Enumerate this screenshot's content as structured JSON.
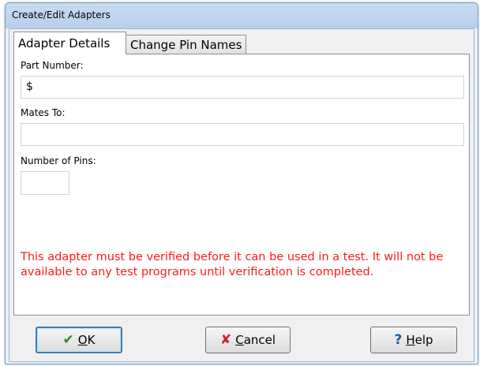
{
  "window": {
    "title": "Create/Edit Adapters"
  },
  "tabs": [
    {
      "label": "Adapter Details",
      "active": true
    },
    {
      "label": "Change Pin Names",
      "active": false
    }
  ],
  "form": {
    "part_number_label": "Part Number:",
    "part_number_value": "$",
    "mates_to_label": "Mates To:",
    "mates_to_value": "",
    "num_pins_label": "Number of Pins:",
    "num_pins_value": ""
  },
  "warning": "This adapter must be verified before it can be used in a test.  It will not be available to any test programs until verification is completed.",
  "buttons": {
    "ok": {
      "mnemonic": "O",
      "rest": "K",
      "icon": "check-icon"
    },
    "cancel": {
      "mnemonic": "C",
      "rest": "ancel",
      "icon": "x-icon"
    },
    "help": {
      "mnemonic": "H",
      "rest": "elp",
      "icon": "question-icon"
    }
  },
  "colors": {
    "warning_text": "#ff1a1a",
    "ok_check": "#2a8a2a",
    "cancel_x": "#c0282a",
    "help_q": "#1a56a8"
  }
}
